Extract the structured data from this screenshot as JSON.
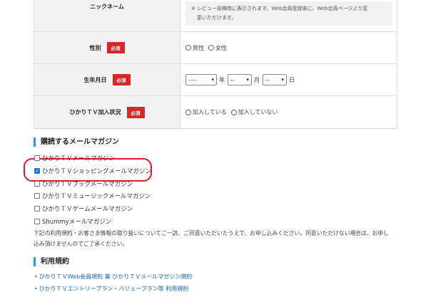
{
  "form": {
    "nickname_label": "ニックネーム",
    "nickname_note_line1": "※ レビュー投稿時に表示されます。Web会員登録後に、Web会員ページより変",
    "nickname_note_line2": "更いただけます。",
    "gender_label": "性別",
    "required_badge": "必須",
    "gender_options": [
      "男性",
      "女性"
    ],
    "birthdate_label": "生年月日",
    "year_placeholder": "----",
    "month_placeholder": "--",
    "day_placeholder": "--",
    "year_unit": "年",
    "month_unit": "月",
    "day_unit": "日",
    "tv_status_label": "ひかりＴＶ加入状況",
    "tv_status_options": [
      "加入している",
      "加入していない"
    ]
  },
  "magazine": {
    "section_title": "購読するメールマガジン",
    "items": [
      {
        "label": "ひかりＴＶメールマガジン",
        "checked": false
      },
      {
        "label": "ひかりＴＶショッピングメールマガジン",
        "checked": true
      },
      {
        "label": "ひかりＴＶブックメールマガジン",
        "checked": false
      },
      {
        "label": "ひかりＴＶミュージックメールマガジン",
        "checked": false
      },
      {
        "label": "ひかりＴＶゲームメールマガジン",
        "checked": false
      },
      {
        "label": "Shummyメールマガジン",
        "checked": false
      }
    ],
    "notice_line1": "下記の利用規約・お客さま情報の取り扱いについてご一読、ご同意いただいたうえで、お申し込みください。同意いただけない場合は、お申し",
    "notice_line2": "込み頂けませんのでご了承ください。"
  },
  "terms": {
    "section_title": "利用規約",
    "links": [
      "ひかりＴＶWeb会員規約 兼 ひかりＴＶメールマガジン規約",
      "ひかりＴＶエントリープラン・バリュープラン等 利用規約"
    ]
  },
  "colors": {
    "required": "#d7272a",
    "accent": "#1aa0e8",
    "link": "#1565c0",
    "highlight": "#e0182a"
  }
}
